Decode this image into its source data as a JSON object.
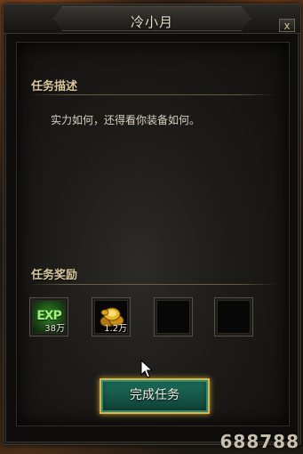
{
  "dialog": {
    "title": "冷小月",
    "close_label": "x"
  },
  "description": {
    "title": "任务描述",
    "text": "实力如何，还得看你装备如何。"
  },
  "rewards": {
    "title": "任务奖励",
    "items": [
      {
        "icon": "exp-icon",
        "label": "EXP",
        "count": "38万"
      },
      {
        "icon": "gold-coins-icon",
        "count": "1.2万"
      },
      {
        "icon": "empty-slot"
      },
      {
        "icon": "empty-slot"
      }
    ]
  },
  "complete_button_label": "完成任务",
  "watermark": "688788",
  "colors": {
    "section_title": "#d8c79b",
    "button_border": "#d7b64a",
    "button_fill": "#1f6f5d"
  }
}
